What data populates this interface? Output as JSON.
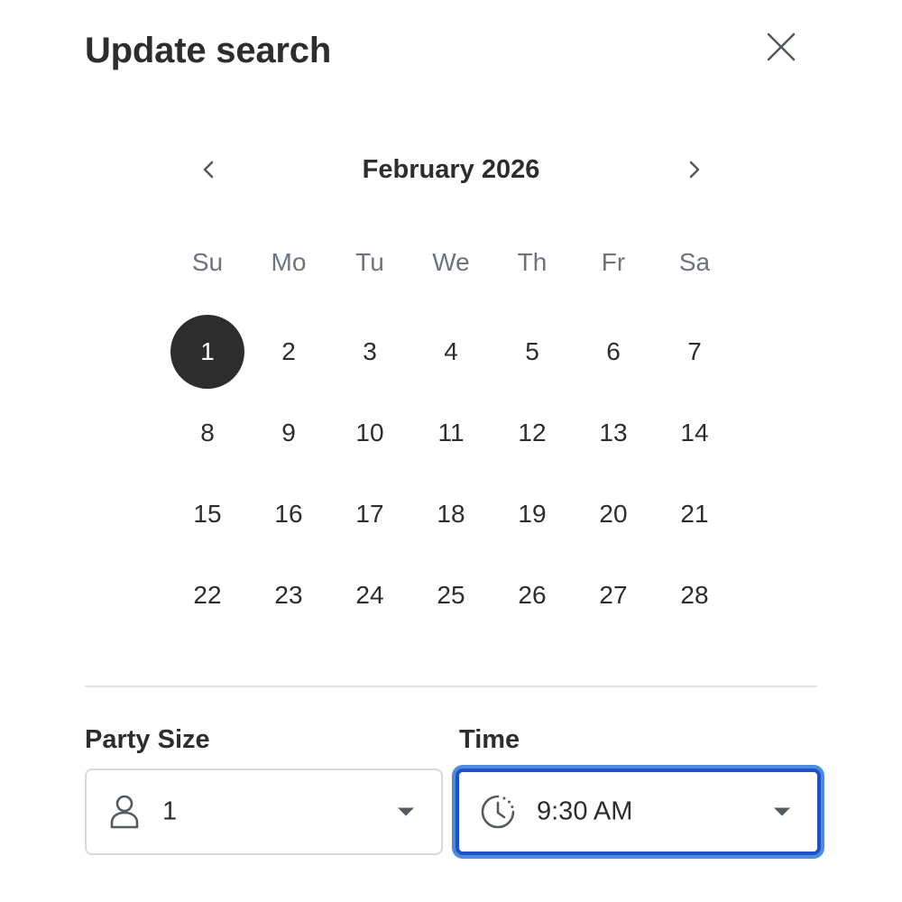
{
  "dialog": {
    "title": "Update search"
  },
  "calendar": {
    "month_label": "February 2026",
    "weekdays": [
      "Su",
      "Mo",
      "Tu",
      "We",
      "Th",
      "Fr",
      "Sa"
    ],
    "weeks": [
      [
        "1",
        "2",
        "3",
        "4",
        "5",
        "6",
        "7"
      ],
      [
        "8",
        "9",
        "10",
        "11",
        "12",
        "13",
        "14"
      ],
      [
        "15",
        "16",
        "17",
        "18",
        "19",
        "20",
        "21"
      ],
      [
        "22",
        "23",
        "24",
        "25",
        "26",
        "27",
        "28"
      ]
    ],
    "selected_day": "1"
  },
  "party_size": {
    "label": "Party Size",
    "value": "1",
    "icon": "person-icon"
  },
  "time": {
    "label": "Time",
    "value": "9:30 AM",
    "icon": "clock-icon"
  },
  "colors": {
    "selected_day_bg": "#2d2d2d",
    "focus_border": "#1f50c7",
    "focus_ring": "#4b8ce0"
  }
}
